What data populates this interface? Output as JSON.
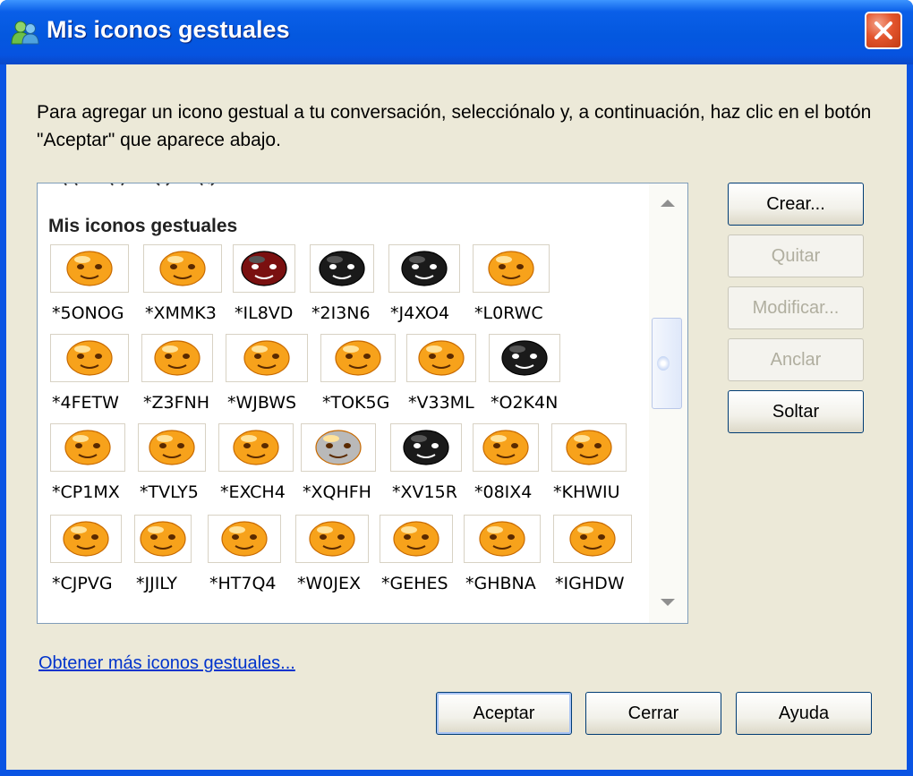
{
  "window": {
    "title": "Mis iconos gestuales"
  },
  "intro_text": "Para agregar un icono gestual a tu conversación, selecciónalo y, a continuación, haz clic en el botón \"Aceptar\" que aparece abajo.",
  "list": {
    "section_heading": "Mis iconos gestuales",
    "rows": [
      [
        {
          "code": "*5ONOG",
          "icon": "smiley-crying-icon"
        },
        {
          "code": "*XMMK3",
          "icon": "smiley-angry-icon"
        },
        {
          "code": "*IL8VD",
          "icon": "devil-face-icon"
        },
        {
          "code": "*2I3N6",
          "icon": "black-bomb-face-icon"
        },
        {
          "code": "*J4XO4",
          "icon": "black-cat-face-icon"
        },
        {
          "code": "*L0RWC",
          "icon": "smiley-sleepy-icon"
        }
      ],
      [
        {
          "code": "*4FETW",
          "icon": "smiley-ninja-icon"
        },
        {
          "code": "*Z3FNH",
          "icon": "smiley-shocked-icon"
        },
        {
          "code": "*WJBWS",
          "icon": "smiley-surprised-icon"
        },
        {
          "code": "*TOK5G",
          "icon": "smiley-money-icon"
        },
        {
          "code": "*V33ML",
          "icon": "smiley-sweating-icon"
        },
        {
          "code": "*O2K4N",
          "icon": "scream-mask-icon"
        }
      ],
      [
        {
          "code": "*CP1MX",
          "icon": "smiley-heart-eyes-icon"
        },
        {
          "code": "*TVLY5",
          "icon": "smiley-yelling-icon"
        },
        {
          "code": "*EXCH4",
          "icon": "smiley-blushing-icon"
        },
        {
          "code": "*XQHFH",
          "icon": "smiley-bandaged-icon"
        },
        {
          "code": "*XV15R",
          "icon": "smiley-afro-icon"
        },
        {
          "code": "*08IX4",
          "icon": "smiley-pouting-icon"
        },
        {
          "code": "*KHWIU",
          "icon": "smiley-sick-icon"
        }
      ],
      [
        {
          "code": "*CJPVG",
          "icon": "smiley-straight-face-icon"
        },
        {
          "code": "*JJILY",
          "icon": "smiley-small-icon"
        },
        {
          "code": "*HT7Q4",
          "icon": "smiley-winking-icon"
        },
        {
          "code": "*W0JEX",
          "icon": "smiley-grinning-icon"
        },
        {
          "code": "*GEHES",
          "icon": "smiley-tear-icon"
        },
        {
          "code": "*GHBNA",
          "icon": "smiley-kiss-icon"
        },
        {
          "code": "*IGHDW",
          "icon": "smiley-bathtub-icon"
        }
      ]
    ]
  },
  "side_buttons": {
    "create": "Crear...",
    "remove": "Quitar",
    "modify": "Modificar...",
    "pin": "Anclar",
    "unpin": "Soltar"
  },
  "link_text": "Obtener más iconos gestuales...",
  "bottom_buttons": {
    "accept": "Aceptar",
    "close": "Cerrar",
    "help": "Ayuda"
  },
  "colors": {
    "title_bar": "#0458df",
    "client_bg": "#ece9d8",
    "close_button": "#e3552d",
    "emoticon_face": "#f7a21b",
    "link": "#0033cc",
    "disabled_text": "#b0ae9f"
  }
}
